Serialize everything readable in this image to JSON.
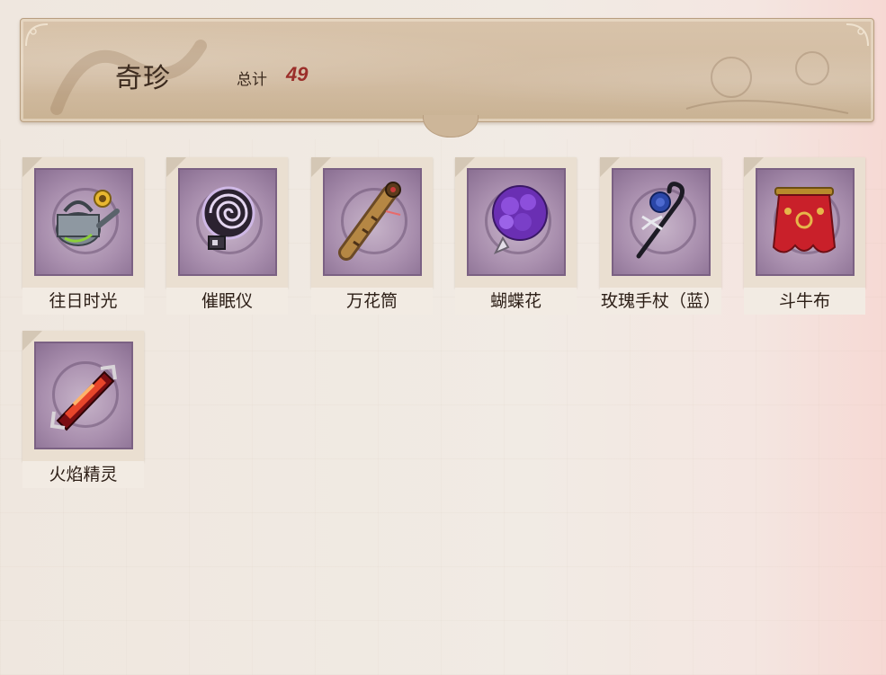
{
  "header": {
    "title": "奇珍",
    "total_label": "总计",
    "total_value": "49"
  },
  "items": [
    {
      "name": "往日时光",
      "icon": "watering-can-icon"
    },
    {
      "name": "催眠仪",
      "icon": "hypnosis-device-icon"
    },
    {
      "name": "万花筒",
      "icon": "kaleidoscope-icon"
    },
    {
      "name": "蝴蝶花",
      "icon": "butterfly-bouquet-icon"
    },
    {
      "name": "玫瑰手杖（蓝）",
      "icon": "blue-rose-cane-icon"
    },
    {
      "name": "斗牛布",
      "icon": "bullfight-cape-icon"
    },
    {
      "name": "火焰精灵",
      "icon": "flame-crystal-icon"
    }
  ],
  "colors": {
    "stamp": "#a48aa8",
    "total_value": "#9b2f2a",
    "text": "#2c1e16"
  }
}
